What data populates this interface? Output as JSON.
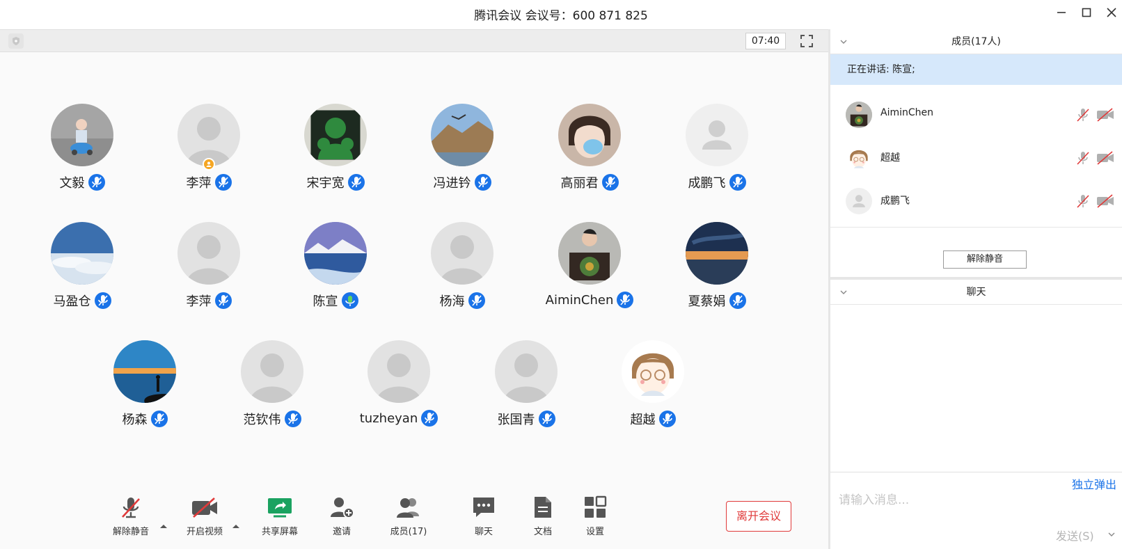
{
  "window": {
    "title": "腾讯会议 会议号：600 871 825"
  },
  "topbar": {
    "timer": "07:40"
  },
  "participants": [
    {
      "name": "文毅",
      "avatar": "photo-child-toy"
    },
    {
      "name": "李萍",
      "avatar": "default",
      "host": true
    },
    {
      "name": "宋宇宽",
      "avatar": "hulk"
    },
    {
      "name": "冯进钤",
      "avatar": "mountain-bird"
    },
    {
      "name": "高丽君",
      "avatar": "anime-mask"
    },
    {
      "name": "成鹏飞",
      "avatar": "default-flat"
    },
    {
      "name": "马盈仓",
      "avatar": "sky-clouds"
    },
    {
      "name": "李萍",
      "avatar": "default"
    },
    {
      "name": "陈宣",
      "avatar": "snow-lake",
      "speaking": true
    },
    {
      "name": "杨海",
      "avatar": "default"
    },
    {
      "name": "AiminChen",
      "avatar": "child-drawing"
    },
    {
      "name": "夏蔡娟",
      "avatar": "sunset-sea"
    },
    {
      "name": "杨森",
      "avatar": "sunset-silhouette"
    },
    {
      "name": "范钦伟",
      "avatar": "default"
    },
    {
      "name": "tuzheyan",
      "avatar": "default"
    },
    {
      "name": "张国青",
      "avatar": "default"
    },
    {
      "name": "超越",
      "avatar": "cartoon-glasses"
    }
  ],
  "toolbar": {
    "unmute": "解除静音",
    "video": "开启视频",
    "share": "共享屏幕",
    "invite": "邀请",
    "members": "成员(17)",
    "chat": "聊天",
    "docs": "文档",
    "settings": "设置",
    "leave": "离开会议"
  },
  "side": {
    "members_header": "成员(17人)",
    "speaking": "正在讲话: 陈宣;",
    "member_list": [
      {
        "name": "AiminChen",
        "avatar": "child-drawing"
      },
      {
        "name": "超越",
        "avatar": "cartoon-glasses"
      },
      {
        "name": "成鹏飞",
        "avatar": "default-flat"
      }
    ],
    "unmute_all": "解除静音",
    "chat_header": "聊天",
    "popout": "独立弹出",
    "chat_placeholder": "请输入消息...",
    "send": "发送(S)"
  },
  "colors": {
    "accent": "#1a73e8",
    "leave": "#e03a3a",
    "speaking_bg": "#d6e8fb",
    "muted_red": "#e03a3a"
  }
}
